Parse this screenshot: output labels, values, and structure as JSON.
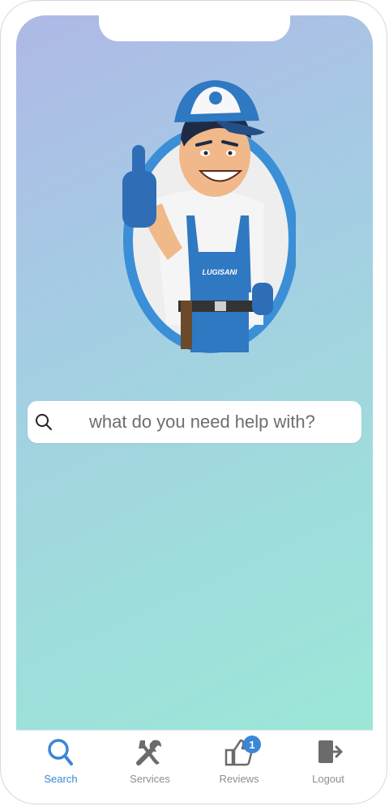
{
  "search": {
    "placeholder": "what do you need help with?"
  },
  "mascot": {
    "logo_text": "LUGISANI",
    "icon": "handyman-thumbs-up-illustration"
  },
  "tabs": [
    {
      "label": "Search",
      "icon": "search-icon",
      "active": true
    },
    {
      "label": "Services",
      "icon": "tools-icon",
      "active": false
    },
    {
      "label": "Reviews",
      "icon": "thumbs-up-icon",
      "active": false,
      "badge": "1"
    },
    {
      "label": "Logout",
      "icon": "logout-icon",
      "active": false
    }
  ],
  "colors": {
    "accent": "#3b86d6",
    "inactive": "#8e8e93"
  }
}
